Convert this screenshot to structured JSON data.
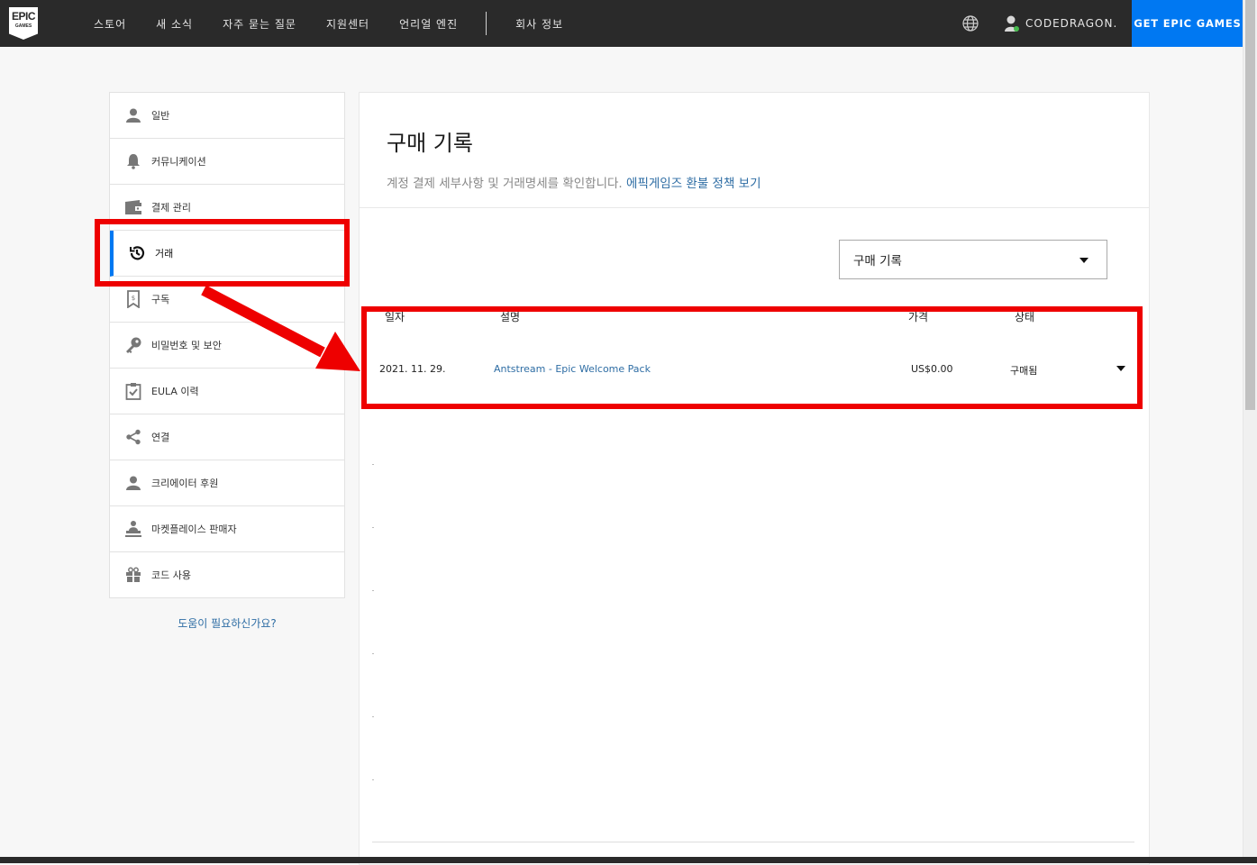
{
  "nav": {
    "logo_line1": "EPIC",
    "logo_line2": "GAMES",
    "items": [
      "스토어",
      "새 소식",
      "자주 묻는 질문",
      "지원센터",
      "언리얼 엔진"
    ],
    "company": "회사 정보",
    "username": "CODEDRAGON.",
    "cta": "GET EPIC GAMES",
    "colors": {
      "bar": "#2a2a2a",
      "cta": "#0078f2"
    }
  },
  "sidebar": {
    "items": [
      {
        "label": "일반",
        "icon": "person-icon"
      },
      {
        "label": "커뮤니케이션",
        "icon": "bell-icon"
      },
      {
        "label": "결제 관리",
        "icon": "wallet-icon"
      },
      {
        "label": "거래",
        "icon": "history-icon"
      },
      {
        "label": "구독",
        "icon": "receipt-icon"
      },
      {
        "label": "비밀번호 및 보안",
        "icon": "key-icon"
      },
      {
        "label": "EULA 이력",
        "icon": "clipboard-check-icon"
      },
      {
        "label": "연결",
        "icon": "share-icon"
      },
      {
        "label": "크리에이터 후원",
        "icon": "person-icon"
      },
      {
        "label": "마켓플레이스 판매자",
        "icon": "seller-icon"
      },
      {
        "label": "코드 사용",
        "icon": "gift-icon"
      }
    ],
    "active": "거래",
    "help": "도움이 필요하신가요?"
  },
  "main": {
    "title": "구매 기록",
    "subtitle": "계정 결제 세부사항 및 거래명세를 확인합니다.",
    "refund_link": "에픽게임즈 환불 정책 보기",
    "filter_value": "구매 기록",
    "columns": [
      "일자",
      "설명",
      "가격",
      "상태"
    ],
    "transactions": [
      {
        "date": "2021. 11. 29.",
        "description": "Antstream - Epic Welcome Pack",
        "price": "US$0.00",
        "status": "구매됨"
      }
    ]
  },
  "annotation_color": "#ee0000"
}
